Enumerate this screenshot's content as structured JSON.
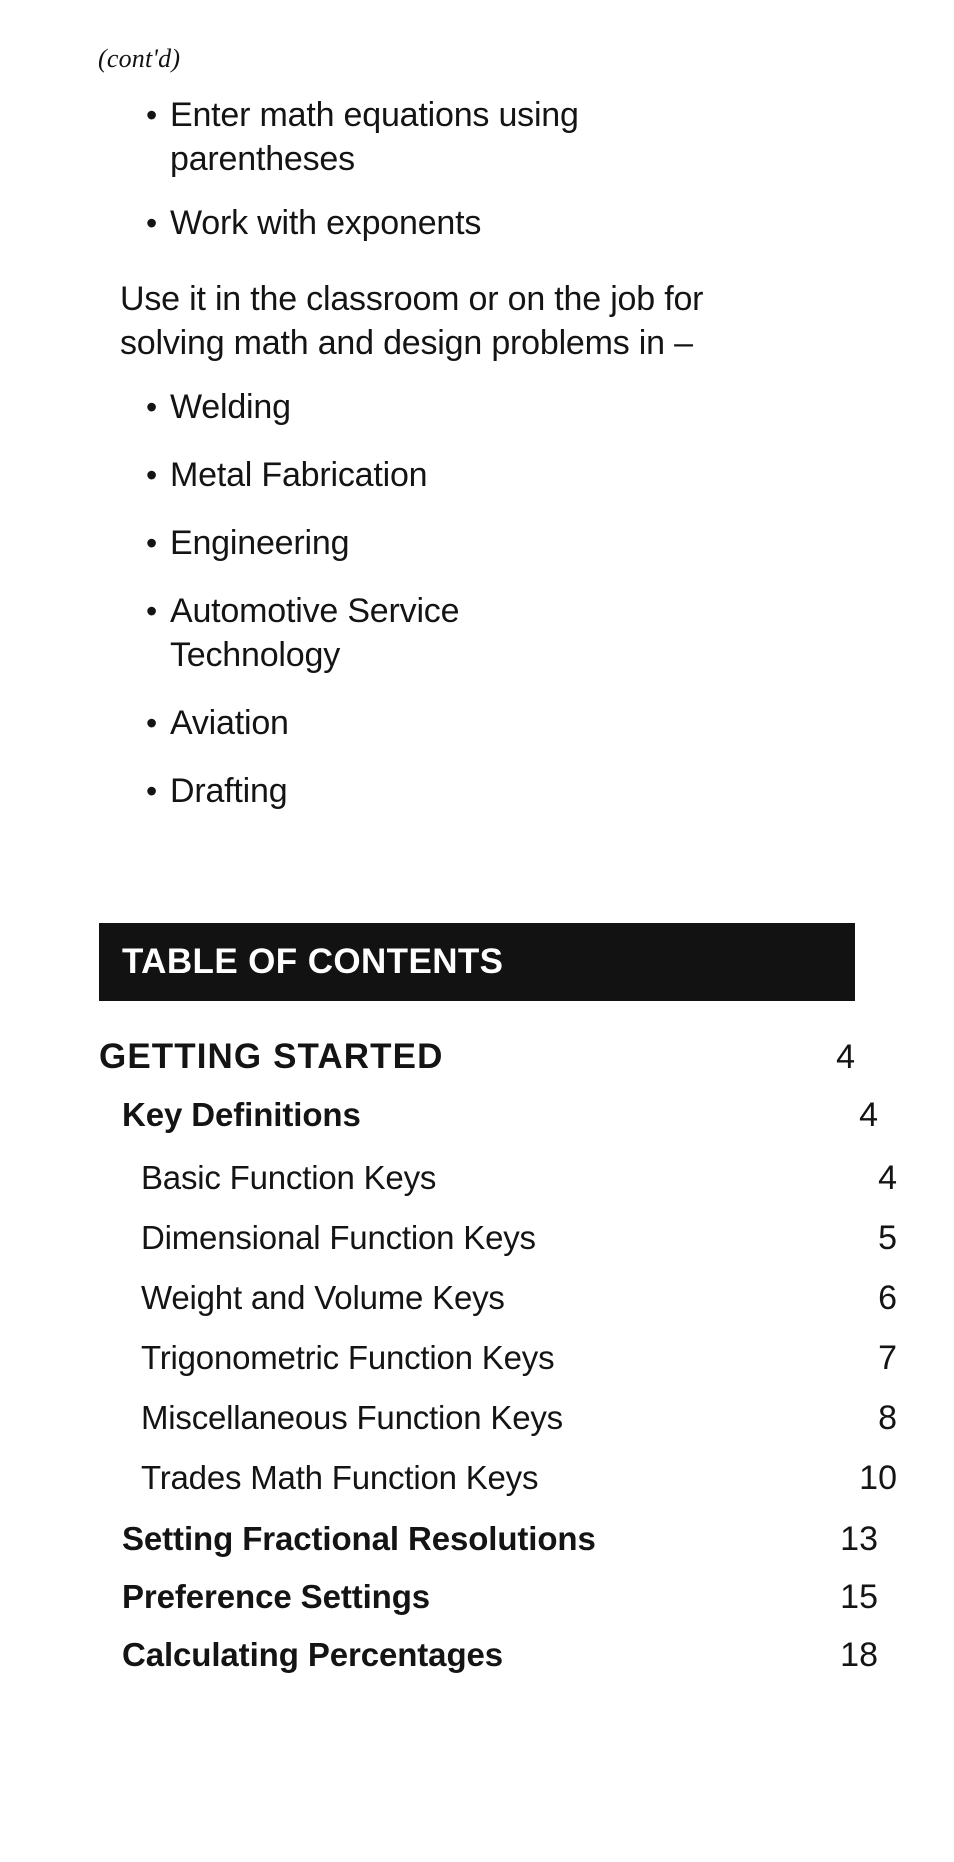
{
  "page": {
    "continued_marker": "(cont'd)"
  },
  "feature_bullets": [
    {
      "bullet": "•",
      "lines": [
        "Enter math equations using",
        "parentheses"
      ]
    },
    {
      "bullet": "•",
      "lines": [
        "Work with exponents"
      ]
    }
  ],
  "paragraph": {
    "lines": [
      "Use it in the classroom or on the job for",
      "solving math and design problems in –"
    ]
  },
  "trade_bullets": [
    {
      "bullet": "•",
      "label": "Welding"
    },
    {
      "bullet": "•",
      "label": "Metal Fabrication"
    },
    {
      "bullet": "•",
      "label": "Engineering"
    },
    {
      "bullet": "•",
      "label": "Automotive Service Technology"
    },
    {
      "bullet": "•",
      "label": "Aviation"
    },
    {
      "bullet": "•",
      "label": "Drafting"
    }
  ],
  "toc": {
    "banner_title": "TABLE OF CONTENTS",
    "banner_bg": "#121212",
    "banner_fg": "#ffffff",
    "entries": [
      {
        "title": "GETTING STARTED",
        "page": "4",
        "level": 0
      },
      {
        "title": "Key Definitions",
        "page": "4",
        "level": 1
      },
      {
        "title": "Basic Function Keys",
        "page": "4",
        "level": 2
      },
      {
        "title": "Dimensional Function Keys",
        "page": "5",
        "level": 2
      },
      {
        "title": "Weight and Volume Keys",
        "page": "6",
        "level": 2
      },
      {
        "title": "Trigonometric Function Keys",
        "page": "7",
        "level": 2
      },
      {
        "title": "Miscellaneous Function Keys",
        "page": "8",
        "level": 2
      },
      {
        "title": "Trades Math Function Keys",
        "page": "10",
        "level": 2
      },
      {
        "title": "Setting Fractional Resolutions",
        "page": "13",
        "level": 1
      },
      {
        "title": "Preference Settings",
        "page": "15",
        "level": 1
      },
      {
        "title": "Calculating Percentages",
        "page": "18",
        "level": 1
      }
    ]
  }
}
